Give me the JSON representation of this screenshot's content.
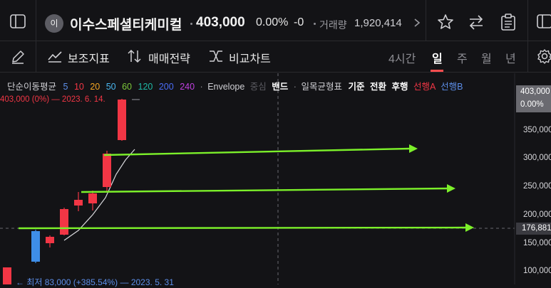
{
  "header": {
    "avatar_char": "이",
    "stock_name": "이수스페셜티케미컬",
    "price": "403,000",
    "change_pct": "0.00%",
    "change_value": "-0",
    "volume_label": "거래량",
    "volume_value": "1,920,414"
  },
  "toolbar": {
    "assist_indicator": "보조지표",
    "trade_strategy": "매매전략",
    "compare_chart": "비교차트",
    "timeframes": [
      "4시간",
      "일",
      "주",
      "월",
      "년"
    ],
    "active_timeframe": "일"
  },
  "legend": {
    "ma_label": "단순이동평균",
    "ma_periods": [
      "5",
      "10",
      "20",
      "50",
      "60",
      "120",
      "200",
      "240"
    ],
    "envelope": "Envelope",
    "envelope_extra": "중심",
    "band": "밴드",
    "ichimoku": "일목균형표",
    "ichimoku_items": [
      "기준",
      "전환",
      "후행",
      "선행A",
      "선행B"
    ],
    "current_price_line": "403,000 (0%) — 2023. 6. 14.",
    "low_note": "← 최저 83,000 (+385.54%) — 2023. 5. 31"
  },
  "axis": {
    "current_price": "403,000",
    "current_pct": "0.00%",
    "ticks": [
      "350,000",
      "300,000",
      "250,000",
      "200,000",
      "150,000",
      "100,000"
    ],
    "crosshair_price": "176,881"
  },
  "colors": {
    "up": "#f23645",
    "down": "#3e8ee8",
    "annotation": "#7cf02a",
    "ma5": "#5c8ee8",
    "ma10": "#f23645",
    "ma20": "#f5a623",
    "ma50": "#7cc83a",
    "ma60": "#a0a0a0",
    "ma120": "#1fb9a6",
    "ma200": "#4a6cf7",
    "ma240": "#c040e0"
  }
}
